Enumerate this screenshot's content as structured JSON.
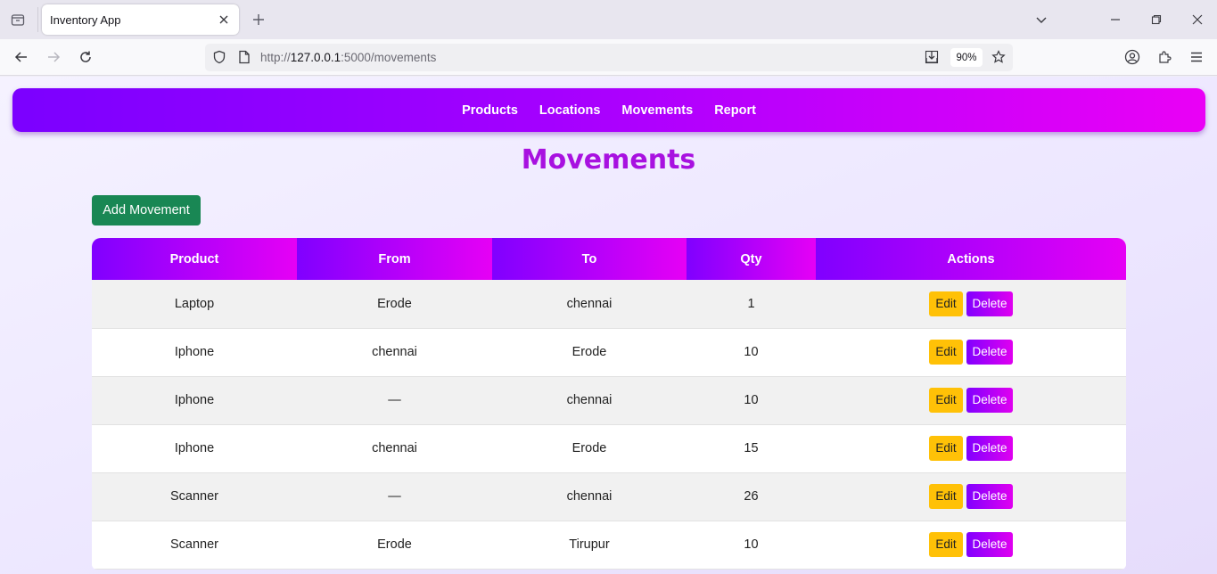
{
  "browser": {
    "tab_title": "Inventory App",
    "url_scheme": "http://",
    "url_host": "127.0.0.1",
    "url_rest": ":5000/movements",
    "zoom": "90%"
  },
  "nav": {
    "items": [
      "Products",
      "Locations",
      "Movements",
      "Report"
    ]
  },
  "page": {
    "title": "Movements",
    "add_button": "Add Movement"
  },
  "table": {
    "columns": [
      "Product",
      "From",
      "To",
      "Qty",
      "Actions"
    ],
    "rows": [
      {
        "product": "Laptop",
        "from": "Erode",
        "to": "chennai",
        "qty": "1"
      },
      {
        "product": "Iphone",
        "from": "chennai",
        "to": "Erode",
        "qty": "10"
      },
      {
        "product": "Iphone",
        "from": "—",
        "to": "chennai",
        "qty": "10"
      },
      {
        "product": "Iphone",
        "from": "chennai",
        "to": "Erode",
        "qty": "15"
      },
      {
        "product": "Scanner",
        "from": "—",
        "to": "chennai",
        "qty": "26"
      },
      {
        "product": "Scanner",
        "from": "Erode",
        "to": "Tirupur",
        "qty": "10"
      }
    ],
    "edit_label": "Edit",
    "delete_label": "Delete"
  },
  "colors": {
    "nav_gradient_start": "#7b00ff",
    "nav_gradient_end": "#ea00f6",
    "heading": "#a811e0",
    "add_button": "#198754",
    "edit_button": "#ffc107"
  }
}
